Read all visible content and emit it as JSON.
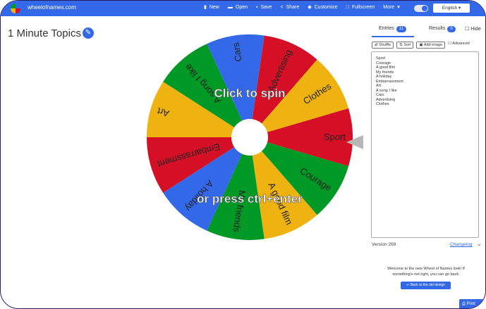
{
  "topbar": {
    "site_name": "wheelofnames.com",
    "menu": [
      "New",
      "Open",
      "Save",
      "Share",
      "Customize",
      "Fullscreen",
      "More"
    ],
    "language": "English"
  },
  "wheel_title": "1 Minute Topics",
  "wheel": {
    "entries": [
      "Sport",
      "Courage",
      "A good film",
      "My friends",
      "A holiday",
      "Embarrassment",
      "Art",
      "A song I like",
      "Cars",
      "Advertising",
      "Clothes"
    ],
    "colors": [
      "#3369e8",
      "#d50f25",
      "#eeb211",
      "#009925"
    ],
    "overlay_line1": "Click to spin",
    "overlay_line2": "or press ctrl+enter"
  },
  "sidebar": {
    "tab_entries": "Entries",
    "entries_count": "11",
    "tab_results": "Results",
    "results_count": "0",
    "hide_label": "Hide",
    "tools": [
      "Shuffle",
      "Sort",
      "Add image"
    ],
    "advanced_label": "Advanced",
    "entries_list": [
      "Sport",
      "Courage",
      "A good film",
      "My friends",
      "A holiday",
      "Embarrassment",
      "Art",
      "A song I like",
      "Cars",
      "Advertising",
      "Clothes"
    ],
    "version": "Version 269",
    "changelog": "Changelog",
    "welcome_text": "Welcome to the new Wheel of Names look! If something's not right, you can go back.",
    "back_button": "Back to the old design"
  },
  "print_button": "Print"
}
